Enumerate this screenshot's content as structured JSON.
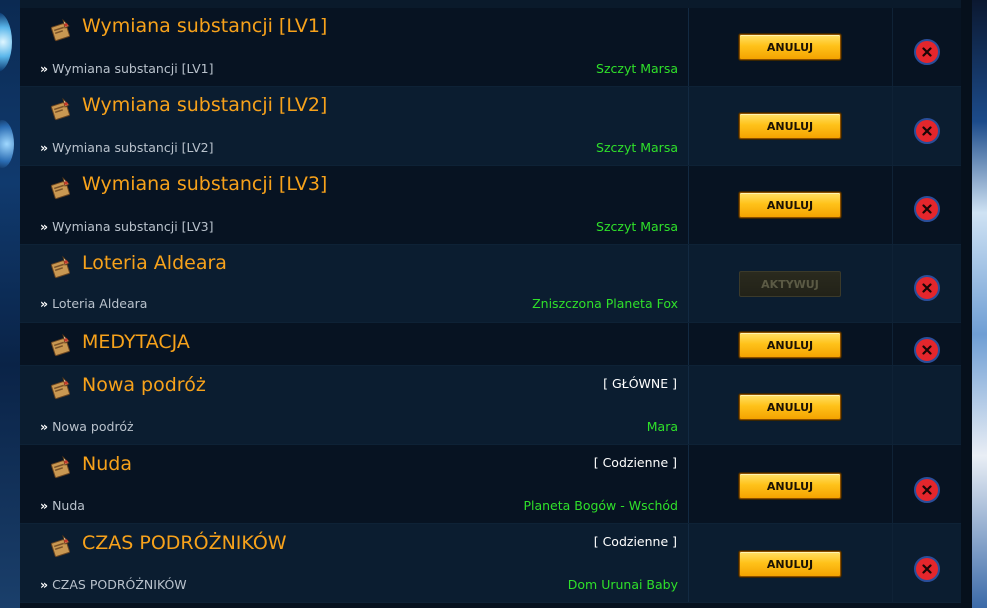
{
  "quests": [
    {
      "title": "Wymiana substancji [LV1]",
      "subtitle": "Wymiana substancji [LV1]",
      "location": "Szczyt Marsa",
      "tag": "",
      "button": "ANULUJ",
      "button_enabled": true
    },
    {
      "title": "Wymiana substancji [LV2]",
      "subtitle": "Wymiana substancji [LV2]",
      "location": "Szczyt Marsa",
      "tag": "",
      "button": "ANULUJ",
      "button_enabled": true
    },
    {
      "title": "Wymiana substancji [LV3]",
      "subtitle": "Wymiana substancji [LV3]",
      "location": "Szczyt Marsa",
      "tag": "",
      "button": "ANULUJ",
      "button_enabled": true
    },
    {
      "title": "Loteria Aldeara",
      "subtitle": "Loteria Aldeara",
      "location": "Zniszczona Planeta Fox",
      "tag": "",
      "button": "AKTYWUJ",
      "button_enabled": false
    },
    {
      "title": "MEDYTACJA",
      "subtitle": "",
      "location": "",
      "tag": "",
      "button": "ANULUJ",
      "button_enabled": true
    },
    {
      "title": "Nowa podróż",
      "subtitle": "Nowa podróż",
      "location": "Mara",
      "tag": "[ GŁÓWNE ]",
      "button": "ANULUJ",
      "button_enabled": true
    },
    {
      "title": "Nuda",
      "subtitle": "Nuda",
      "location": "Planeta Bogów - Wschód",
      "tag": "[ Codzienne ]",
      "button": "ANULUJ",
      "button_enabled": true
    },
    {
      "title": "CZAS PODRÓŻNIKÓW",
      "subtitle": "CZAS PODRÓŻNIKÓW",
      "location": "Dom Urunai Baby",
      "tag": "[ Codzienne ]",
      "button": "ANULUJ",
      "button_enabled": true
    }
  ],
  "subtitle_prefix": "»",
  "icons": {
    "quest": "quest-scroll-icon",
    "close": "close-icon"
  },
  "colors": {
    "title": "#f7a21b",
    "location": "#2fe02a",
    "button": "#ffc21a",
    "close": "#e4262c"
  }
}
